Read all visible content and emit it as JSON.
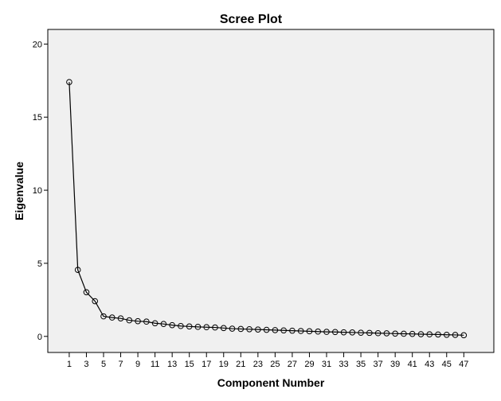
{
  "chart_data": {
    "type": "line",
    "title": "Scree Plot",
    "xlabel": "Component Number",
    "ylabel": "Eigenvalue",
    "ylim": [
      -1.1,
      21
    ],
    "xlim": [
      -1.5,
      50.5
    ],
    "y_ticks": [
      0,
      5,
      10,
      15,
      20
    ],
    "x_ticks": [
      1,
      3,
      5,
      7,
      9,
      11,
      13,
      15,
      17,
      19,
      21,
      23,
      25,
      27,
      29,
      31,
      33,
      35,
      37,
      39,
      41,
      43,
      45,
      47
    ],
    "grid": false,
    "legend": "none",
    "colors": {
      "plot_background": "#f0f0f0",
      "line": "#000000",
      "marker": "#000000"
    },
    "x": [
      1,
      2,
      3,
      4,
      5,
      6,
      7,
      8,
      9,
      10,
      11,
      12,
      13,
      14,
      15,
      16,
      17,
      18,
      19,
      20,
      21,
      22,
      23,
      24,
      25,
      26,
      27,
      28,
      29,
      30,
      31,
      32,
      33,
      34,
      35,
      36,
      37,
      38,
      39,
      40,
      41,
      42,
      43,
      44,
      45,
      46,
      47
    ],
    "series": [
      {
        "name": "Eigenvalue",
        "values": [
          17.4,
          4.55,
          3.02,
          2.41,
          1.37,
          1.29,
          1.23,
          1.1,
          1.04,
          1.01,
          0.9,
          0.85,
          0.77,
          0.71,
          0.68,
          0.65,
          0.63,
          0.61,
          0.57,
          0.53,
          0.51,
          0.49,
          0.47,
          0.45,
          0.43,
          0.41,
          0.39,
          0.37,
          0.35,
          0.33,
          0.31,
          0.3,
          0.28,
          0.27,
          0.25,
          0.24,
          0.22,
          0.21,
          0.19,
          0.18,
          0.17,
          0.15,
          0.14,
          0.13,
          0.11,
          0.1,
          0.08
        ]
      }
    ]
  }
}
